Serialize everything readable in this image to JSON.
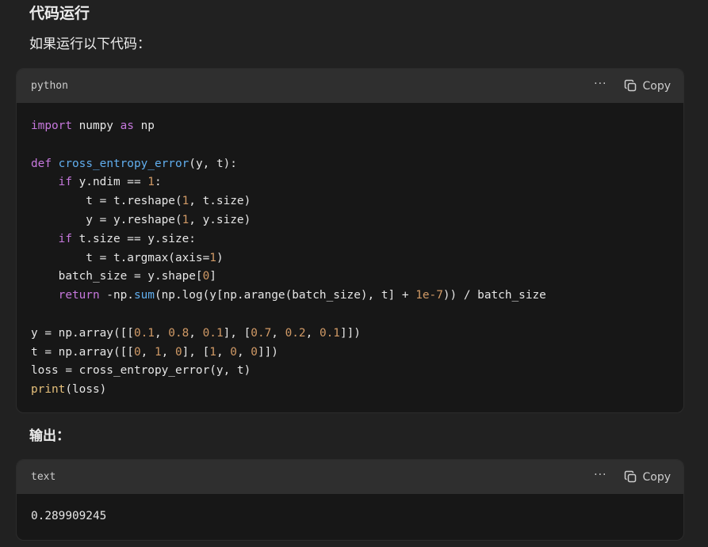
{
  "heading": "代码运行",
  "intro": "如果运行以下代码：",
  "output_label": "输出：",
  "code_block": {
    "language": "python",
    "more_label": "···",
    "copy_label": "Copy",
    "lines": [
      [
        {
          "t": "import",
          "c": "kw"
        },
        {
          "t": " numpy "
        },
        {
          "t": "as",
          "c": "kw"
        },
        {
          "t": " np"
        }
      ],
      [],
      [
        {
          "t": "def",
          "c": "kw"
        },
        {
          "t": " "
        },
        {
          "t": "cross_entropy_error",
          "c": "fn"
        },
        {
          "t": "(y, t):"
        }
      ],
      [
        {
          "t": "    "
        },
        {
          "t": "if",
          "c": "kw"
        },
        {
          "t": " y.ndim == "
        },
        {
          "t": "1",
          "c": "num"
        },
        {
          "t": ":"
        }
      ],
      [
        {
          "t": "        t = t.reshape("
        },
        {
          "t": "1",
          "c": "num"
        },
        {
          "t": ", t.size)"
        }
      ],
      [
        {
          "t": "        y = y.reshape("
        },
        {
          "t": "1",
          "c": "num"
        },
        {
          "t": ", y.size)"
        }
      ],
      [
        {
          "t": "    "
        },
        {
          "t": "if",
          "c": "kw"
        },
        {
          "t": " t.size == y.size:"
        }
      ],
      [
        {
          "t": "        t = t.argmax(axis="
        },
        {
          "t": "1",
          "c": "num"
        },
        {
          "t": ")"
        }
      ],
      [
        {
          "t": "    batch_size = y.shape["
        },
        {
          "t": "0",
          "c": "num"
        },
        {
          "t": "]"
        }
      ],
      [
        {
          "t": "    "
        },
        {
          "t": "return",
          "c": "kw"
        },
        {
          "t": " -np."
        },
        {
          "t": "sum",
          "c": "fn"
        },
        {
          "t": "(np.log(y[np.arange(batch_size), t] + "
        },
        {
          "t": "1e-7",
          "c": "num"
        },
        {
          "t": ")) / batch_size"
        }
      ],
      [],
      [
        {
          "t": "y = np.array([["
        },
        {
          "t": "0.1",
          "c": "num"
        },
        {
          "t": ", "
        },
        {
          "t": "0.8",
          "c": "num"
        },
        {
          "t": ", "
        },
        {
          "t": "0.1",
          "c": "num"
        },
        {
          "t": "], ["
        },
        {
          "t": "0.7",
          "c": "num"
        },
        {
          "t": ", "
        },
        {
          "t": "0.2",
          "c": "num"
        },
        {
          "t": ", "
        },
        {
          "t": "0.1",
          "c": "num"
        },
        {
          "t": "]])"
        }
      ],
      [
        {
          "t": "t = np.array([["
        },
        {
          "t": "0",
          "c": "num"
        },
        {
          "t": ", "
        },
        {
          "t": "1",
          "c": "num"
        },
        {
          "t": ", "
        },
        {
          "t": "0",
          "c": "num"
        },
        {
          "t": "], ["
        },
        {
          "t": "1",
          "c": "num"
        },
        {
          "t": ", "
        },
        {
          "t": "0",
          "c": "num"
        },
        {
          "t": ", "
        },
        {
          "t": "0",
          "c": "num"
        },
        {
          "t": "]])"
        }
      ],
      [
        {
          "t": "loss = cross_entropy_error(y, t)"
        }
      ],
      [
        {
          "t": "print",
          "c": "bi"
        },
        {
          "t": "(loss)"
        }
      ]
    ]
  },
  "output_block": {
    "language": "text",
    "more_label": "···",
    "copy_label": "Copy",
    "value": "0.289909245"
  },
  "colors": {
    "background": "#212121",
    "code_background": "#171717",
    "header_background": "#2f2f2f",
    "keyword": "#c678dd",
    "function": "#61aeee",
    "number": "#d19a66",
    "builtin": "#e6c07b"
  },
  "icons": {
    "more": "ellipsis-icon",
    "copy": "copy-icon"
  }
}
